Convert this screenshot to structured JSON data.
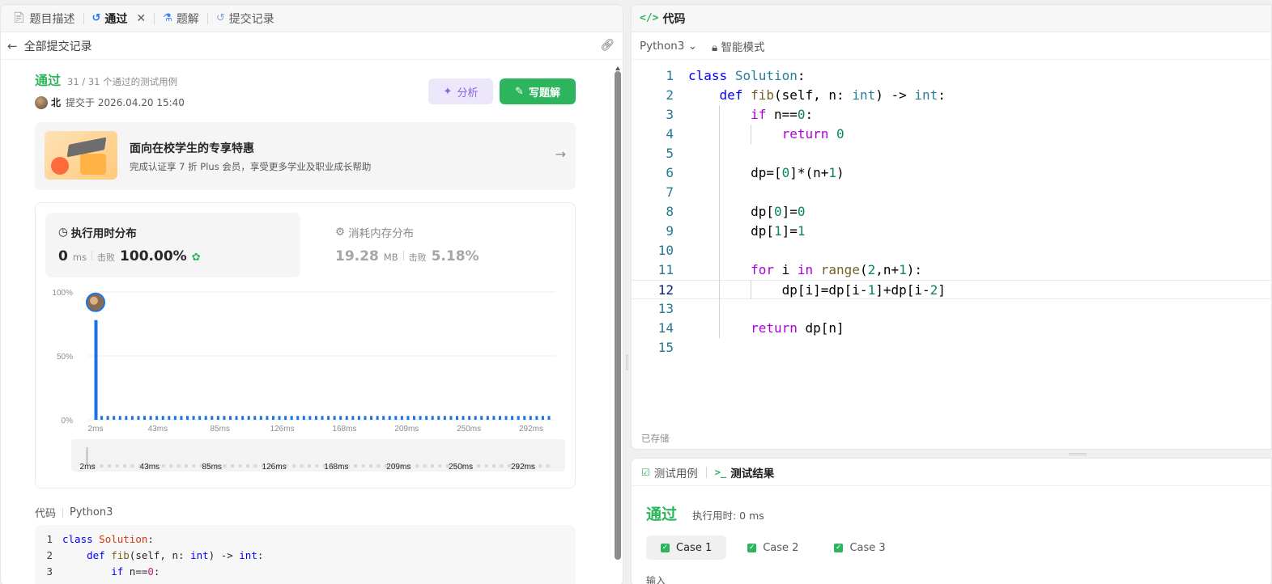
{
  "tabs": [
    {
      "label": "题目描述",
      "icon": "document-icon"
    },
    {
      "label": "通过",
      "icon": "history-icon",
      "active": true
    },
    {
      "label": "题解",
      "icon": "flask-icon"
    },
    {
      "label": "提交记录",
      "icon": "history-icon"
    }
  ],
  "back_label": "全部提交记录",
  "submission": {
    "status": "通过",
    "cases": "31 / 31 个通过的测试用例",
    "user": "北",
    "submitted_at": "提交于 2026.04.20 15:40",
    "analyze_label": "分析",
    "write_label": "写题解"
  },
  "promo": {
    "title": "面向在校学生的专享特惠",
    "subtitle": "完成认证享 7 折 Plus 会员，享受更多学业及职业成长帮助"
  },
  "perf": {
    "runtime_title": "执行用时分布",
    "runtime_value": "0",
    "runtime_unit": "ms",
    "beat_label": "击败",
    "runtime_beat": "100.00%",
    "memory_title": "消耗内存分布",
    "memory_value": "19.28",
    "memory_unit": "MB",
    "memory_beat": "5.18%"
  },
  "chart_data": {
    "type": "bar",
    "y_ticks": [
      "100%",
      "50%",
      "0%"
    ],
    "x_ticks": [
      "2ms",
      "43ms",
      "85ms",
      "126ms",
      "168ms",
      "209ms",
      "250ms",
      "292ms"
    ],
    "ylim": [
      0,
      100
    ],
    "values": [
      78,
      3,
      3,
      3,
      3,
      3,
      3,
      3,
      3,
      3,
      3,
      3,
      3,
      3,
      3,
      3,
      3,
      3,
      3,
      3,
      3,
      3,
      3,
      3,
      3,
      3,
      3,
      3,
      3,
      3,
      3,
      3,
      3,
      3,
      3,
      3,
      3,
      3,
      3,
      3,
      3,
      3,
      3,
      3,
      3,
      3,
      3,
      3,
      3,
      3,
      3,
      3,
      3,
      3,
      3,
      3,
      3,
      3,
      3,
      3,
      3,
      3,
      3,
      3,
      3,
      3,
      3,
      3,
      3,
      3,
      3,
      3,
      3,
      3,
      3
    ],
    "bar_color": "#1a73e8",
    "grid": true
  },
  "code_section": {
    "label": "代码",
    "lang": "Python3"
  },
  "editor": {
    "title": "代码",
    "lang": "Python3",
    "mode": "智能模式",
    "saved": "已存储",
    "lines": [
      "class Solution:",
      "    def fib(self, n: int) -> int:",
      "        if n==0:",
      "            return 0",
      "",
      "        dp=[0]*(n+1)",
      "",
      "        dp[0]=0",
      "        dp[1]=1",
      "",
      "        for i in range(2,n+1):",
      "            dp[i]=dp[i-1]+dp[i-2]",
      "",
      "        return dp[n]",
      ""
    ]
  },
  "result": {
    "tab_cases": "测试用例",
    "tab_result": "测试结果",
    "status": "通过",
    "time": "执行用时: 0 ms",
    "cases": [
      "Case 1",
      "Case 2",
      "Case 3"
    ],
    "input_label": "输入"
  }
}
